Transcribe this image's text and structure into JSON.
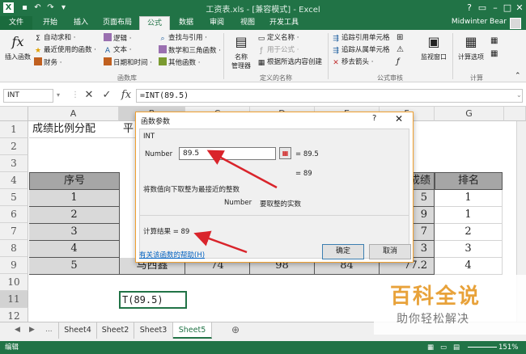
{
  "window": {
    "title": "工资表.xls - [兼容模式] - Excel",
    "account": "Midwinter Bear",
    "qat_icons": [
      "excel-logo-icon",
      "save-icon",
      "undo-icon",
      "redo-icon",
      "customize-icon"
    ]
  },
  "ribbon": {
    "tabs": [
      "文件",
      "开始",
      "插入",
      "页面布局",
      "公式",
      "数据",
      "审阅",
      "视图",
      "开发工具"
    ],
    "active_tab": "公式",
    "insert_function": "插入函数",
    "library": {
      "items": [
        "自动求和 ·",
        "最近使用的函数 ·",
        "财务 ·",
        "逻辑 ·",
        "文本 ·",
        "日期和时间 ·",
        "查找与引用 ·",
        "数学和三角函数 ·",
        "其他函数 ·"
      ],
      "group_name": "函数库"
    },
    "names": {
      "manager": "名称\n管理器",
      "items": [
        "定义名称 ·",
        "用于公式 ·",
        "根据所选内容创建"
      ],
      "group_name": "定义的名称"
    },
    "audit": {
      "items": [
        "追踪引用单元格",
        "追踪从属单元格",
        "移去箭头 ·"
      ],
      "watch": "监视窗口",
      "group_name": "公式审核"
    },
    "calc": {
      "options": "计算选项",
      "group_name": "计算"
    }
  },
  "formula_bar": {
    "name_box": "INT",
    "formula": "=INT(89.5)"
  },
  "sheet": {
    "columns": [
      "A",
      "B",
      "C",
      "D",
      "E",
      "F",
      "G"
    ],
    "rows": [
      "1",
      "2",
      "3",
      "4",
      "5",
      "6",
      "7",
      "8",
      "9",
      "10",
      "11",
      "12"
    ],
    "title_cell": "成绩比例分配",
    "title_cell_b": "平",
    "header": {
      "seq": "序号",
      "score": "成绩",
      "rank": "排名"
    },
    "seq_values": [
      "1",
      "2",
      "3",
      "4",
      "5"
    ],
    "row9_name": "马西鑫",
    "row9_c": "74",
    "row9_d": "98",
    "row9_e": "84",
    "row9_f": "77.2",
    "f_partial": [
      "5",
      "9",
      "7",
      "3",
      "2"
    ],
    "rank_values": [
      "1",
      "1",
      "2",
      "3",
      "4"
    ],
    "edit_cell": "T(89.5)"
  },
  "dialog": {
    "title": "函数参数",
    "help": "?",
    "close": "✕",
    "func": "INT",
    "arg_label": "Number",
    "arg_value": "89.5",
    "arg_result": "=  89.5",
    "result_eq": "=  89",
    "description": "将数值向下取整为最接近的整数",
    "arg_desc_label": "Number",
    "arg_desc": "要取整的实数",
    "calc_result": "计算结果 =  89",
    "help_link": "有关该函数的帮助(H)",
    "ok": "确定",
    "cancel": "取消"
  },
  "sheet_tabs": {
    "ellipsis": "...",
    "tabs": [
      "Sheet4",
      "Sheet2",
      "Sheet3",
      "Sheet5"
    ],
    "active": "Sheet5"
  },
  "status": {
    "mode": "编辑",
    "zoom": "151%"
  },
  "watermark": {
    "main": "百科全说",
    "sub": "助你轻松解决"
  },
  "colors": {
    "excel_green": "#217346",
    "arrow_red": "#d9242b",
    "dialog_border": "#f0a030"
  }
}
